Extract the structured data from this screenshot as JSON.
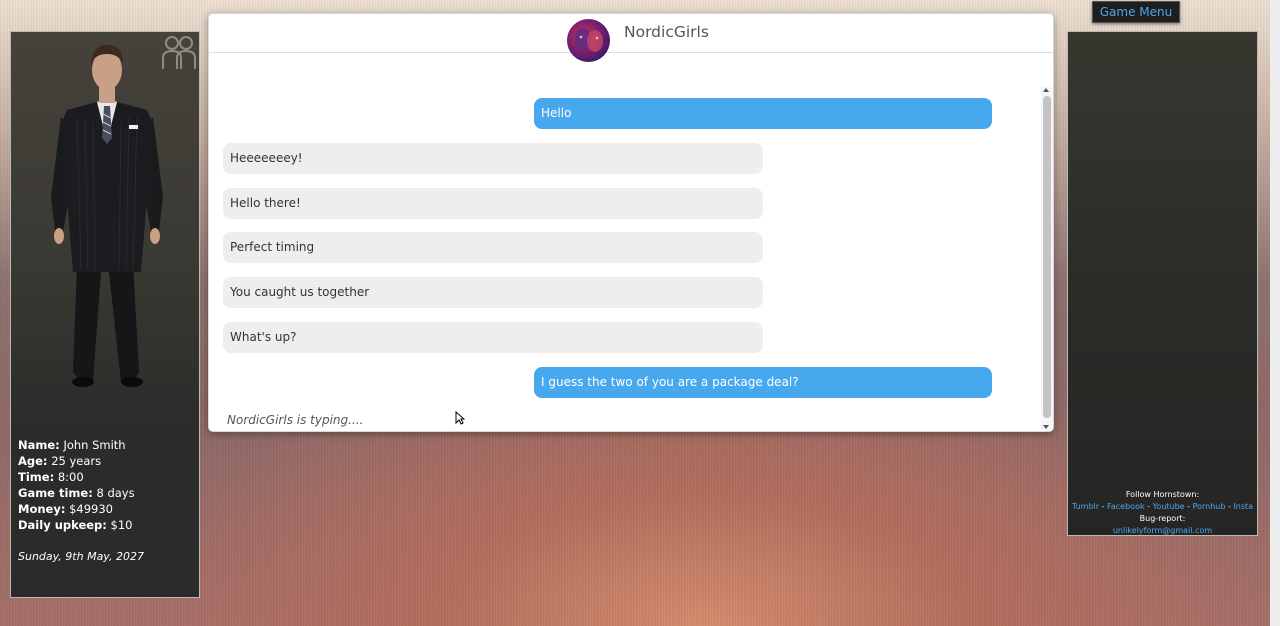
{
  "player": {
    "name_label": "Name:",
    "name": "John Smith",
    "age_label": "Age:",
    "age": "25 years",
    "time_label": "Time:",
    "time": "8:00",
    "game_time_label": "Game time:",
    "game_time": "8 days",
    "money_label": "Money:",
    "money": "$49930",
    "upkeep_label": "Daily upkeep:",
    "upkeep": "$10",
    "date": "Sunday, 9th May, 2027"
  },
  "chat": {
    "title": "NordicGirls",
    "messages": [
      {
        "from": "me",
        "text": "Hello"
      },
      {
        "from": "them",
        "text": "Heeeeeeey!"
      },
      {
        "from": "them",
        "text": "Hello there!"
      },
      {
        "from": "them",
        "text": "Perfect timing"
      },
      {
        "from": "them",
        "text": "You caught us together"
      },
      {
        "from": "them",
        "text": "What's up?"
      },
      {
        "from": "me",
        "text": "I guess the two of you are a package deal?"
      }
    ],
    "typing": "NordicGirls is typing...."
  },
  "menu": {
    "game_menu": "Game Menu"
  },
  "footer": {
    "follow": "Follow Hornstown:",
    "links": [
      "Tumblr",
      "Facebook",
      "Youtube",
      "Pornhub",
      "Insta"
    ],
    "bug_label": "Bug-report:",
    "email": "unlikelyform@gmail.com"
  },
  "colors": {
    "sent_bubble": "#48a8ee",
    "received_bubble": "#eeeeee",
    "link": "#4aa8f0"
  },
  "icons": [
    "group-icon",
    "cursor-icon"
  ]
}
